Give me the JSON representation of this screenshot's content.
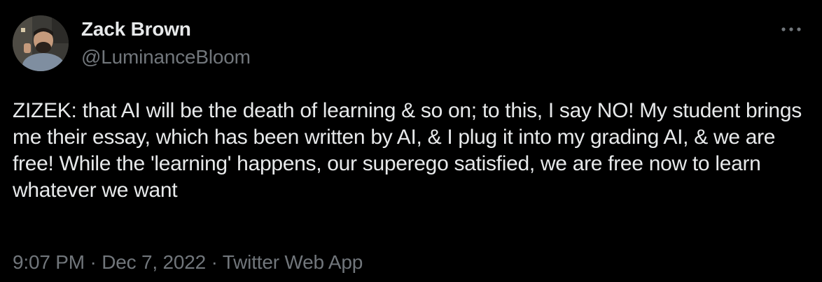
{
  "author": {
    "display_name": "Zack Brown",
    "handle": "@LuminanceBloom",
    "avatar_icon": "profile-photo"
  },
  "tweet": {
    "text": "ZIZEK: that AI will be the death of learning & so on; to this, I say NO! My student brings me their essay, which has been written by AI, & I plug it into my grading AI, & we are free! While the 'learning' happens, our superego satisfied, we are free now to learn whatever we want"
  },
  "meta": {
    "time": "9:07 PM",
    "separator": "·",
    "date": "Dec 7, 2022",
    "source": "Twitter Web App"
  },
  "menu": {
    "more_icon": "more-horizontal-icon"
  },
  "colors": {
    "background": "#000000",
    "text_primary": "#e7e9ea",
    "text_secondary": "#71767b"
  }
}
